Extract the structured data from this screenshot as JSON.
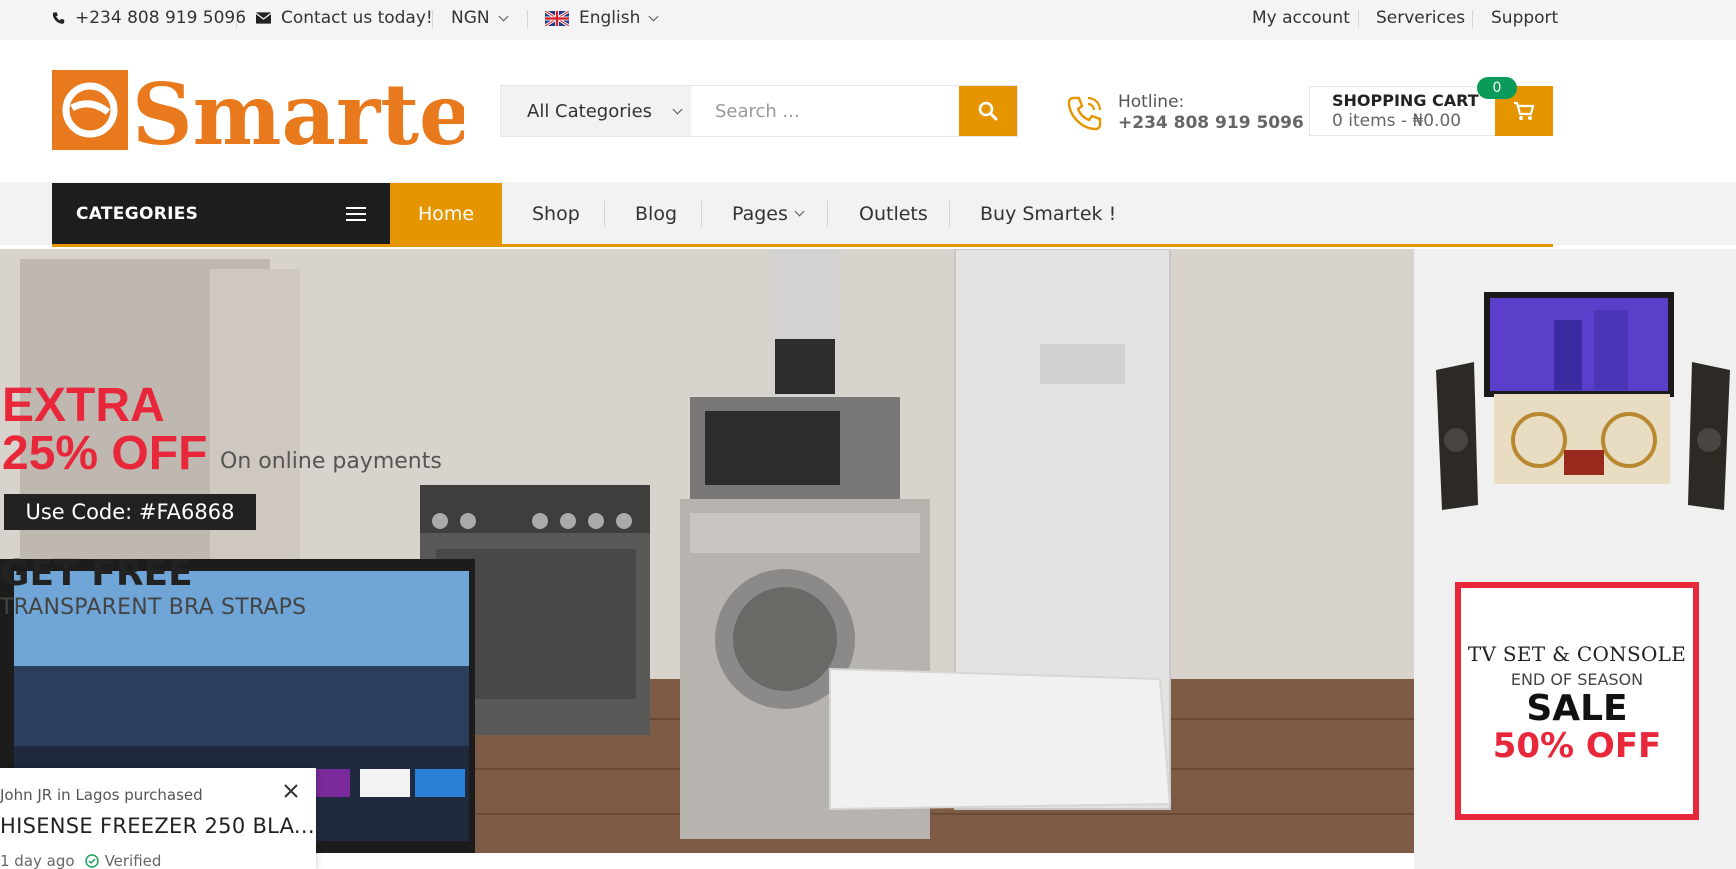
{
  "topbar": {
    "phone": "+234 808 919 5096",
    "contact": "Contact us today!",
    "currency": "NGN",
    "language": "English",
    "links": [
      "My account",
      "Serverices",
      "Support"
    ]
  },
  "header": {
    "logo_text": "Smartek",
    "category_select": "All Categories",
    "search_placeholder": "Search ...",
    "hotline_label": "Hotline:",
    "hotline_number": "+234 808 919 5096",
    "cart_title": "SHOPPING CART",
    "cart_summary": "0 items - ₦0.00",
    "cart_count": "0"
  },
  "nav": {
    "categories_label": "CATEGORIES",
    "items": [
      "Home",
      "Shop",
      "Blog",
      "Pages",
      "Outlets",
      "Buy Smartek !"
    ]
  },
  "hero": {
    "extra": "EXTRA",
    "percent_off": "25% OFF",
    "online": "On online payments",
    "code": "Use Code: #FA6868",
    "free_title": "GET FREE",
    "free_sub": "TRANSPARENT BRA STRAPS"
  },
  "side_banner": {
    "line1": "TV SET & CONSOLE",
    "line2": "END OF SEASON",
    "line3": "SALE",
    "line4": "50% OFF"
  },
  "popup": {
    "who": "John JR in Lagos purchased",
    "product": "HISENSE FREEZER 250 BLA...",
    "time": "1 day ago",
    "verified": "Verified"
  },
  "colors": {
    "accent": "#e49500",
    "dark": "#1d1d1d",
    "promo_red": "#e8283a",
    "badge_green": "#0a9a5a",
    "logo_orange": "#e8791c"
  }
}
